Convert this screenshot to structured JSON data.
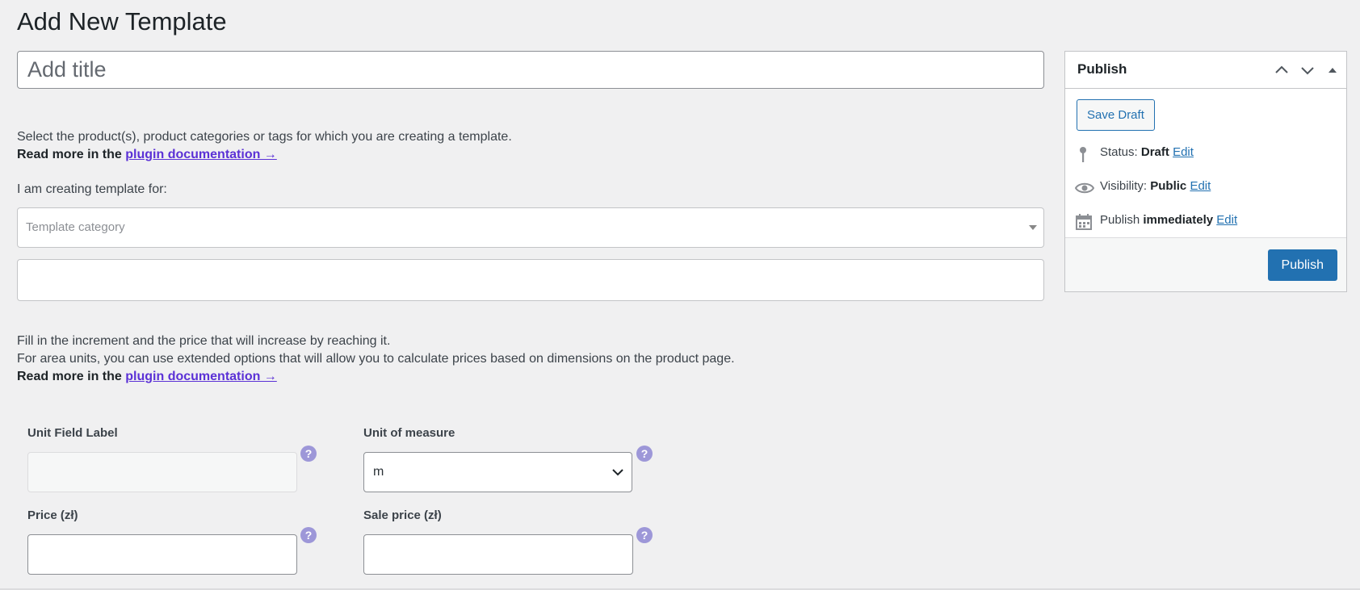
{
  "page": {
    "title": "Add New Template"
  },
  "title_input": {
    "placeholder": "Add title"
  },
  "intro": {
    "line1": "Select the product(s), product categories or tags for which you are creating a template.",
    "read_more_prefix": "Read more in the",
    "doc_link": "plugin documentation →",
    "creating_for": "I am creating template for:"
  },
  "template_select": {
    "placeholder": "Template category"
  },
  "increment": {
    "line1": "Fill in the increment and the price that will increase by reaching it.",
    "line2": "For area units, you can use extended options that will allow you to calculate prices based on dimensions on the product page.",
    "read_more_prefix": "Read more in the",
    "doc_link": "plugin documentation →"
  },
  "fields": {
    "unit_field_label": "Unit Field Label",
    "unit_of_measure": "Unit of measure",
    "unit_value": "m",
    "price": "Price (zł)",
    "sale_price": "Sale price (zł)",
    "help": "?"
  },
  "publish": {
    "title": "Publish",
    "save_draft": "Save Draft",
    "status_label": "Status:",
    "status_value": "Draft",
    "visibility_label": "Visibility:",
    "visibility_value": "Public",
    "publish_label": "Publish",
    "publish_value": "immediately",
    "edit": "Edit",
    "publish_button": "Publish"
  },
  "colors": {
    "accent": "#2271b1",
    "link": "#5b31d6",
    "help_icon": "#9d97d8"
  }
}
